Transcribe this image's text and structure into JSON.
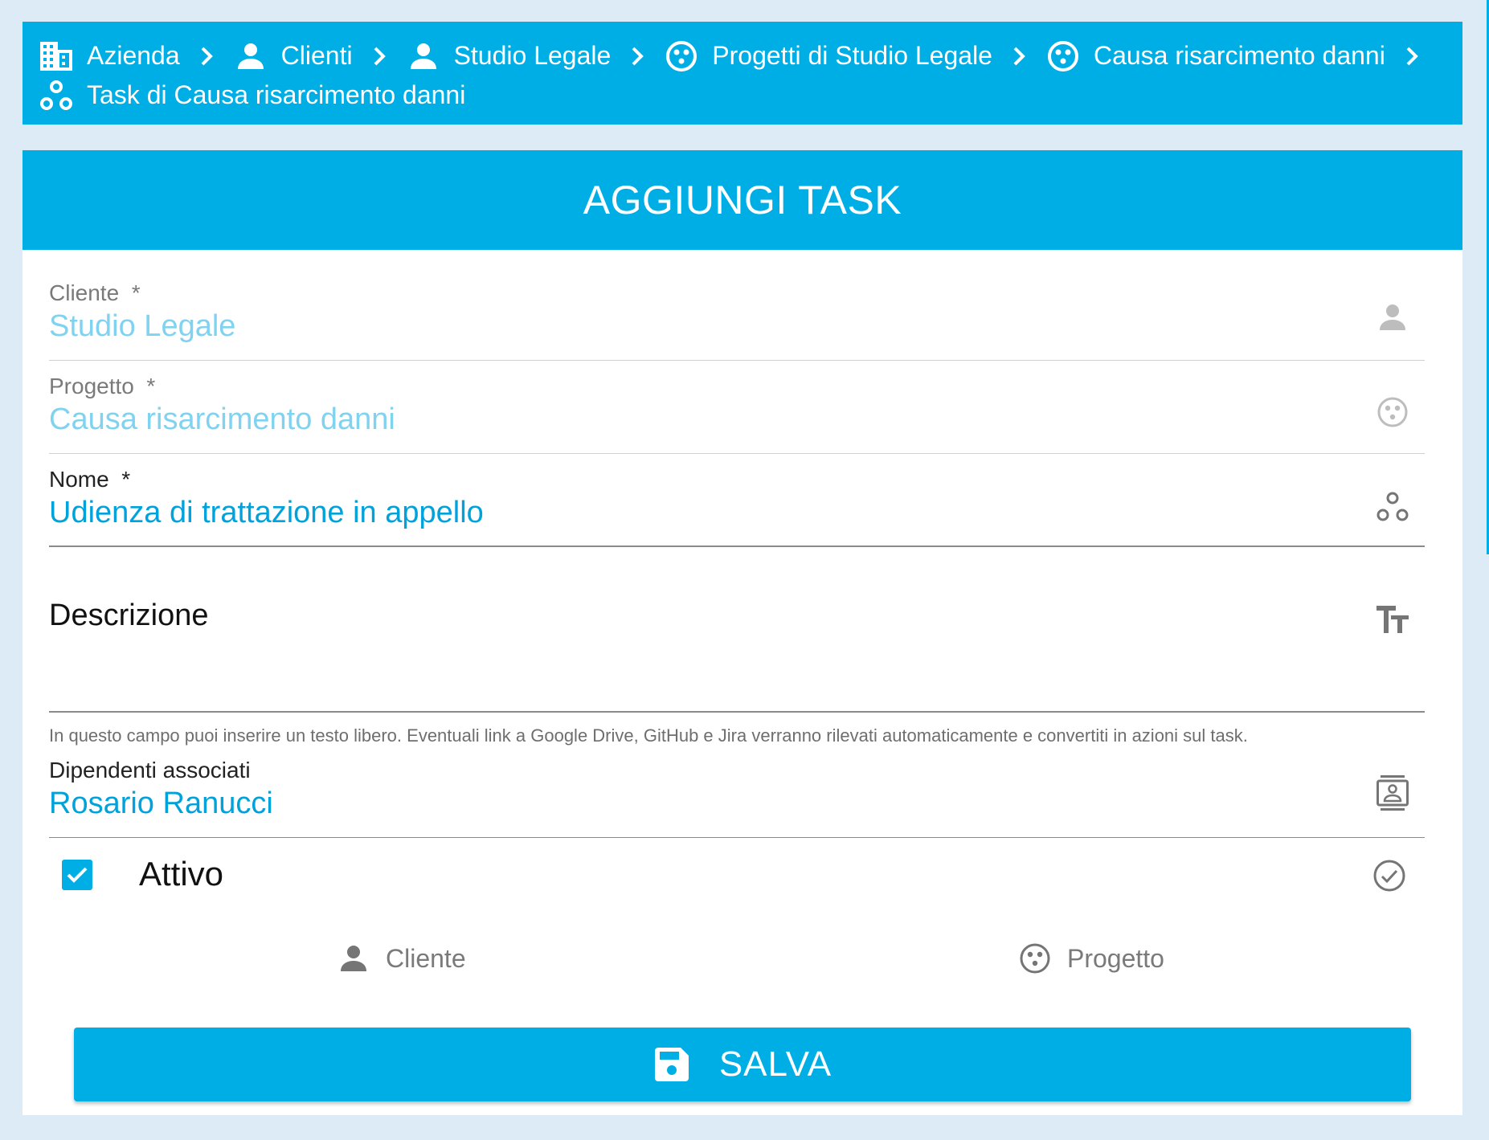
{
  "breadcrumb": {
    "items": [
      {
        "label": "Azienda",
        "icon": "building-icon"
      },
      {
        "label": "Clienti",
        "icon": "person-icon"
      },
      {
        "label": "Studio Legale",
        "icon": "person-icon"
      },
      {
        "label": "Progetti di Studio Legale",
        "icon": "project-icon"
      },
      {
        "label": "Causa risarcimento danni",
        "icon": "project-icon"
      },
      {
        "label": "Task di Causa risarcimento danni",
        "icon": "bubbles-icon"
      }
    ]
  },
  "header": {
    "title": "AGGIUNGI TASK"
  },
  "form": {
    "cliente": {
      "label": "Cliente",
      "required": "*",
      "value": "Studio Legale",
      "icon": "person-icon"
    },
    "progetto": {
      "label": "Progetto",
      "required": "*",
      "value": "Causa risarcimento danni",
      "icon": "project-icon"
    },
    "nome": {
      "label": "Nome",
      "required": "*",
      "value": "Udienza di trattazione in appello",
      "icon": "bubbles-icon"
    },
    "descrizione": {
      "label": "Descrizione",
      "value": "",
      "icon": "text-format-icon"
    },
    "hint": "In questo campo puoi inserire un testo libero. Eventuali link a Google Drive, GitHub e Jira verranno rilevati automaticamente e convertiti in azioni sul task.",
    "dipendenti": {
      "label": "Dipendenti associati",
      "value": "Rosario Ranucci",
      "icon": "contacts-icon"
    },
    "attivo": {
      "label": "Attivo",
      "checked": true,
      "icon": "check-circle-icon"
    }
  },
  "tabs": [
    {
      "label": "Cliente",
      "icon": "person-icon"
    },
    {
      "label": "Progetto",
      "icon": "project-icon"
    }
  ],
  "save": {
    "label": "SALVA",
    "icon": "floppy-icon"
  },
  "colors": {
    "accent": "#00aee6",
    "background": "#dcebf5",
    "active_text": "#00a2dc",
    "disabled_text": "#80d3f0"
  }
}
